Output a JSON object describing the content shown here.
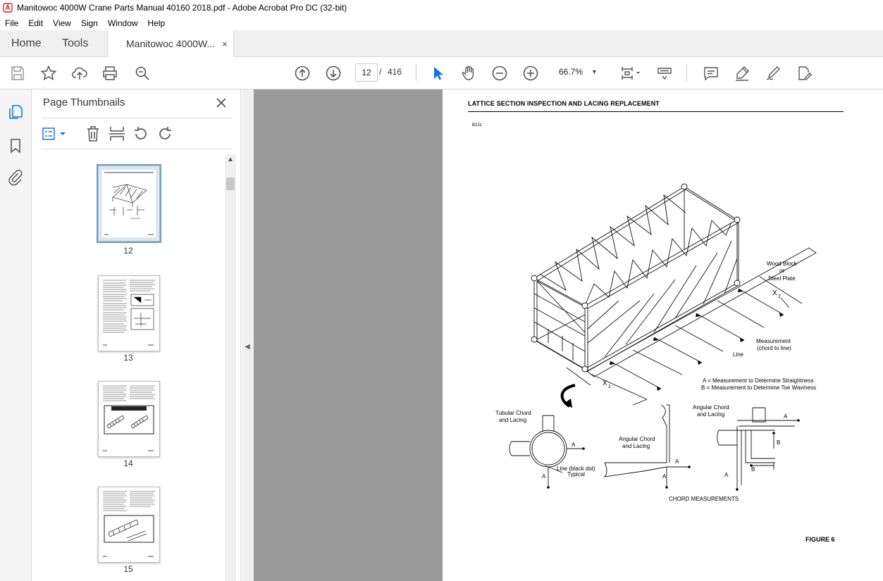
{
  "window": {
    "title": "Manitowoc 4000W Crane Parts Manual 40160 2018.pdf - Adobe Acrobat Pro DC (32-bit)"
  },
  "menu": [
    "File",
    "Edit",
    "View",
    "Sign",
    "Window",
    "Help"
  ],
  "tabs": {
    "home": "Home",
    "tools": "Tools",
    "document": "Manitowoc 4000W...",
    "close": "×"
  },
  "toolbar": {
    "current_page": "12",
    "page_separator": "/",
    "total_pages": "416",
    "zoom": "66.7%"
  },
  "panel": {
    "title": "Page Thumbnails",
    "thumbnails": [
      {
        "page": "12",
        "selected": true
      },
      {
        "page": "13",
        "selected": false
      },
      {
        "page": "14",
        "selected": false
      },
      {
        "page": "15",
        "selected": false
      }
    ]
  },
  "document_page": {
    "heading": "LATTICE SECTION INSPECTION AND LACING REPLACEMENT",
    "code": "B231",
    "figure": "FIGURE 6",
    "labels": {
      "wood_block": "Wood Block",
      "or": "or",
      "steel_plate": "Steel Plate",
      "x2": "X",
      "x2_sub": "2",
      "measurement": "Measurement",
      "chord_to_line": "(chord to line)",
      "line": "Line",
      "x1": "X",
      "x1_sub": "1",
      "legend_a": "A = Measurement to Determine Straightness",
      "legend_b": "B = Measurement to Determine Toe Waviness",
      "tubular_1": "Tubular Chord",
      "tubular_2": "and Lacing",
      "angular_mid_1": "Angular Chord",
      "angular_mid_2": "and Lacing",
      "angular_right_1": "Angular Chord",
      "angular_right_2": "and Lacing",
      "line_black_dot": "Line (black dot)",
      "typical": "Typical",
      "a": "A",
      "b": "B",
      "chord_measurements": "CHORD MEASUREMENTS"
    }
  }
}
